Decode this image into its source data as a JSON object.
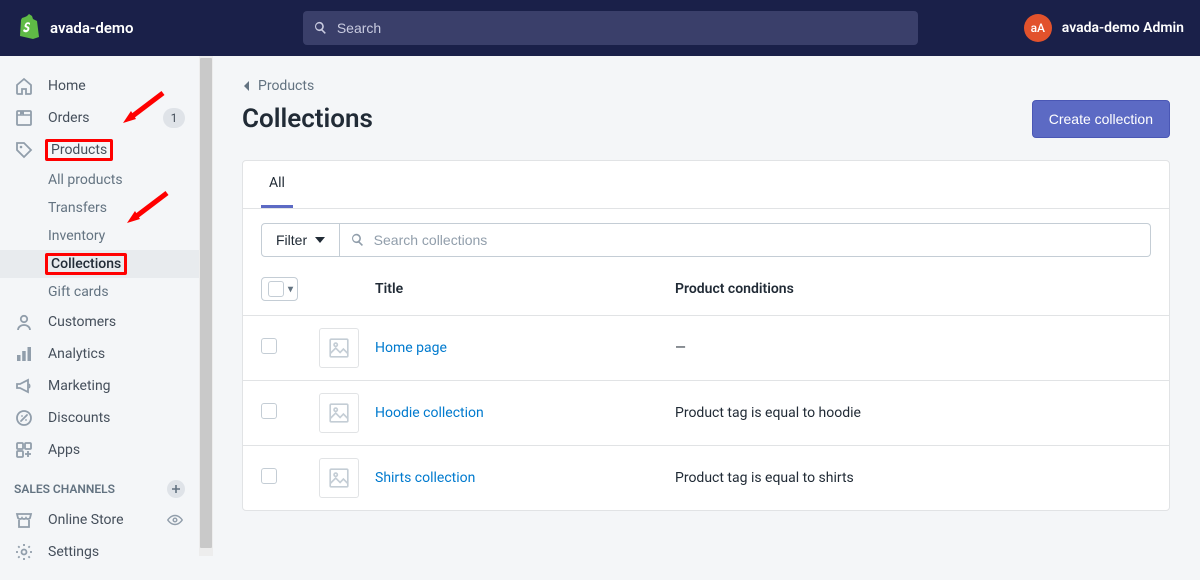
{
  "topbar": {
    "store_name": "avada-demo",
    "search_placeholder": "Search",
    "avatar_initials": "aA",
    "admin_name": "avada-demo Admin"
  },
  "sidebar": {
    "home": "Home",
    "orders": "Orders",
    "orders_badge": "1",
    "products": "Products",
    "products_sub": {
      "all_products": "All products",
      "transfers": "Transfers",
      "inventory": "Inventory",
      "collections": "Collections",
      "gift_cards": "Gift cards"
    },
    "customers": "Customers",
    "analytics": "Analytics",
    "marketing": "Marketing",
    "discounts": "Discounts",
    "apps": "Apps",
    "sales_channels_label": "SALES CHANNELS",
    "online_store": "Online Store",
    "settings": "Settings"
  },
  "main": {
    "breadcrumb": "Products",
    "title": "Collections",
    "create_btn": "Create collection",
    "tabs": {
      "all": "All"
    },
    "filter_label": "Filter",
    "search_placeholder": "Search collections",
    "columns": {
      "title": "Title",
      "conditions": "Product conditions"
    },
    "rows": [
      {
        "title": "Home page",
        "conditions": "—"
      },
      {
        "title": "Hoodie collection",
        "conditions": "Product tag is equal to hoodie"
      },
      {
        "title": "Shirts collection",
        "conditions": "Product tag is equal to shirts"
      }
    ]
  }
}
